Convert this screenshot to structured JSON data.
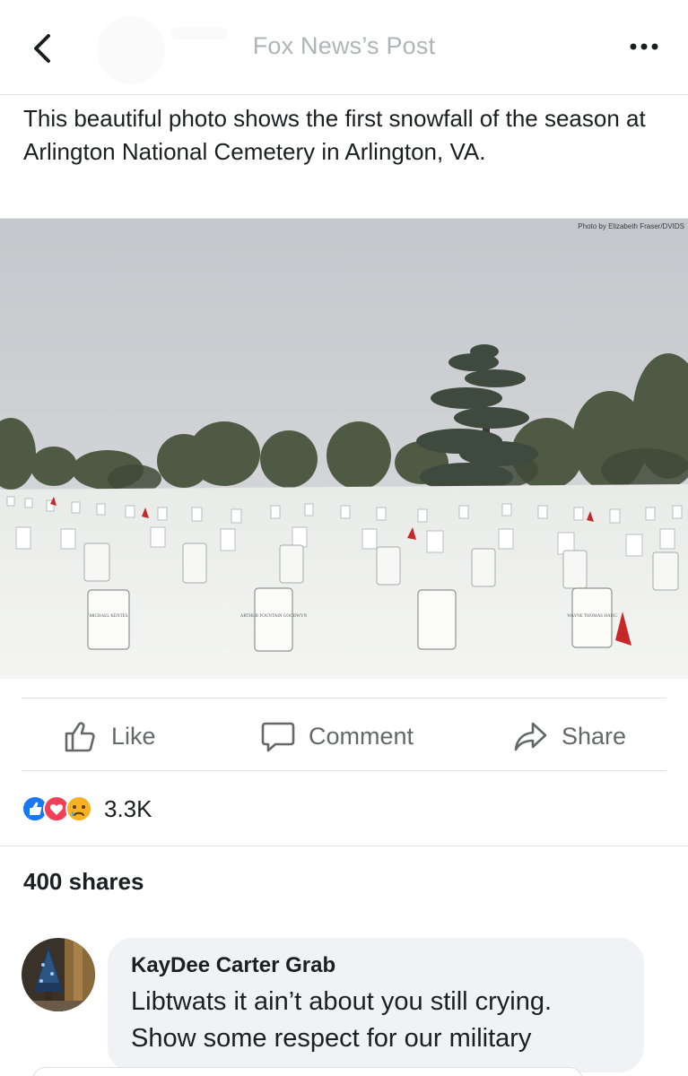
{
  "header": {
    "title": "Fox News’s Post",
    "back_icon": "chevron-left-icon",
    "more_icon": "more-horizontal-icon"
  },
  "post": {
    "text": "This beautiful photo shows the first snowfall of the season at Arlington National Cemetery in Arlington, VA.",
    "photo_credit": "Photo by Elizabeth Fraser/DVIDS",
    "headstone_inscriptions": [
      "MICHAEL KENTES",
      "ARTHUR FOUNTAIN GOODWYN",
      "WAYNE THOMAS HAUG"
    ]
  },
  "actions": {
    "like": "Like",
    "comment": "Comment",
    "share": "Share"
  },
  "reactions": {
    "icons": [
      "like-reaction-icon",
      "love-reaction-icon",
      "sad-reaction-icon"
    ],
    "count": "3.3K"
  },
  "shares": "400 shares",
  "comment": {
    "author": "KayDee Carter Grab",
    "line1": "Libtwats it ain’t about you still crying.",
    "line2": "Show some respect for our military"
  },
  "colors": {
    "like_blue": "#1877f2",
    "love_red": "#f33e58",
    "sad_yellow": "#f7b125",
    "muted_text": "#65676b",
    "bubble_bg": "#f0f2f5"
  }
}
